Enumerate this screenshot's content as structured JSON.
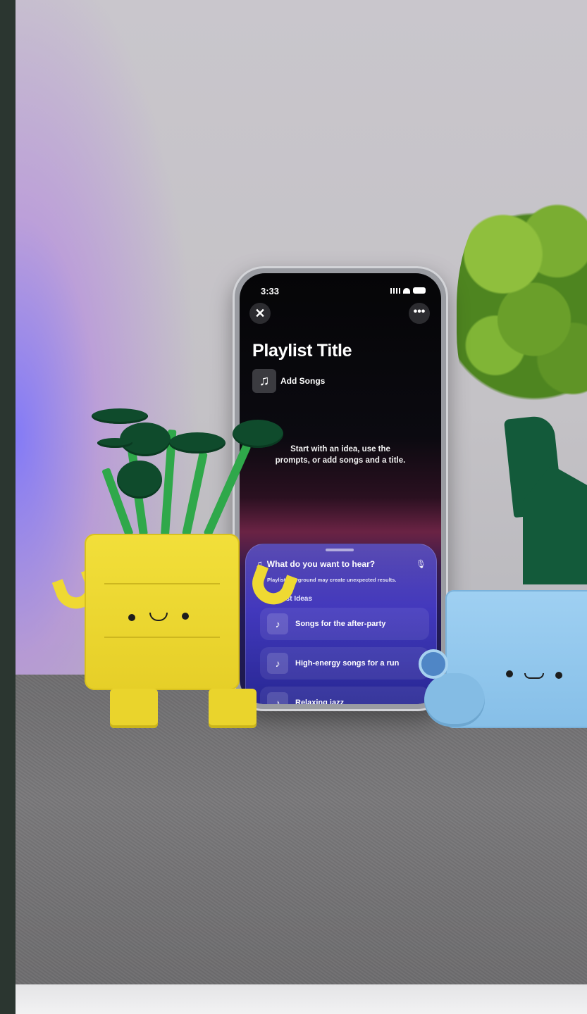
{
  "phone": {
    "status_time": "3:33",
    "title": "Playlist Title",
    "add_songs_label": "Add Songs",
    "hint_line1": "Start with an idea, use the",
    "hint_line2": "prompts, or add songs and a title.",
    "prompt_placeholder": "What do you want to hear?",
    "disclaimer": "Playlist Playground may create unexpected results.",
    "section_label": "aylist Ideas",
    "ideas": [
      {
        "label": "Songs for the after-party"
      },
      {
        "label": "High-energy songs for a run"
      },
      {
        "label": "Relaxing jazz"
      }
    ]
  },
  "colors": {
    "yellow_figure": "#f2df3a",
    "blue_figure": "#9fd0f2",
    "sheet_accent": "#4f46c6"
  }
}
